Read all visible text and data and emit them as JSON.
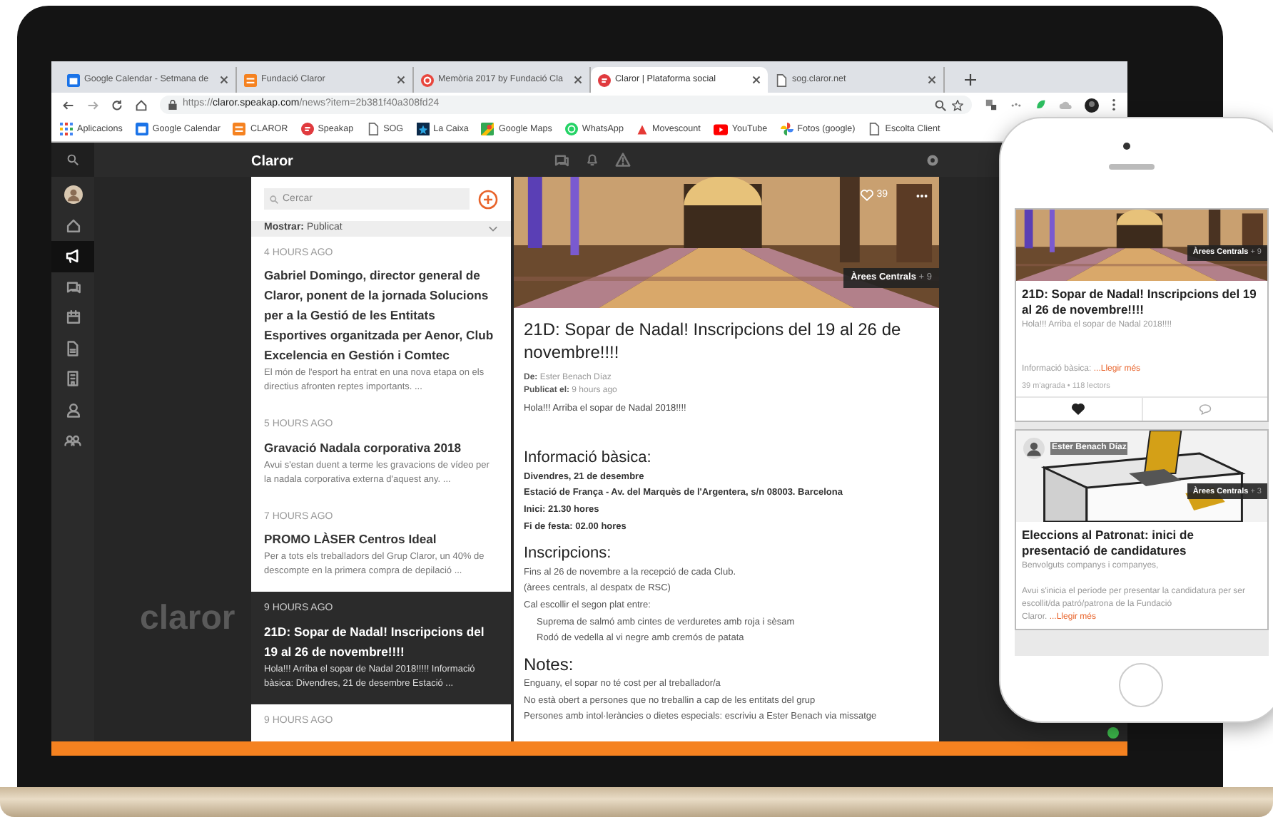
{
  "browser": {
    "tabs": [
      {
        "kind": "calendar",
        "title": "Google Calendar - Setmana de",
        "selected": false
      },
      {
        "kind": "claror",
        "title": "Fundació Claror",
        "selected": false
      },
      {
        "kind": "target",
        "title": "Memòria 2017 by Fundació Cla",
        "selected": false
      },
      {
        "kind": "speakap",
        "title": "Claror | Plataforma social",
        "selected": true
      },
      {
        "kind": "page",
        "title": "sog.claror.net",
        "selected": false
      }
    ],
    "url": {
      "scheme": "https://",
      "host": "claror.speakap.com",
      "path": "/news?item=2b381f40a308fd24"
    },
    "bookmarks": [
      {
        "kind": "apps",
        "label": "Aplicacions"
      },
      {
        "kind": "calendar",
        "label": "Google Calendar"
      },
      {
        "kind": "claror",
        "label": "CLAROR"
      },
      {
        "kind": "speakap",
        "label": "Speakap"
      },
      {
        "kind": "page",
        "label": "SOG"
      },
      {
        "kind": "bank",
        "label": "La Caixa"
      },
      {
        "kind": "maps",
        "label": "Google Maps"
      },
      {
        "kind": "whatsapp",
        "label": "WhatsApp"
      },
      {
        "kind": "triangle",
        "label": "Movescount"
      },
      {
        "kind": "youtube",
        "label": "YouTube"
      },
      {
        "kind": "photos",
        "label": "Fotos (google)"
      },
      {
        "kind": "page",
        "label": "Escolta Client"
      }
    ]
  },
  "app": {
    "title": "Claror",
    "logo": "claror",
    "sidebar": [
      {
        "kind": "avatar",
        "selected": false
      },
      {
        "kind": "home",
        "selected": false
      },
      {
        "kind": "megaphone",
        "selected": true
      },
      {
        "kind": "chat",
        "selected": false
      },
      {
        "kind": "calendar",
        "selected": false
      },
      {
        "kind": "document",
        "selected": false
      },
      {
        "kind": "building",
        "selected": false
      },
      {
        "kind": "user",
        "selected": false
      },
      {
        "kind": "group",
        "selected": false
      }
    ],
    "feed": {
      "search_placeholder": "Cercar",
      "filter_label": "Mostrar:",
      "filter_value": "Publicat",
      "items": [
        {
          "time": "4 HOURS AGO",
          "title": "Gabriel Domingo, director general de Claror, ponent de la jornada Solucions per a la Gestió de les Entitats Esportives organitzada per Aenor, Club Excelencia en Gestión i Comtec",
          "excerpt": "El món de l'esport ha entrat en una nova etapa on els directius afronten reptes importants. ...",
          "selected": false
        },
        {
          "time": "5 HOURS AGO",
          "title": "Gravació Nadala corporativa 2018",
          "excerpt": "Avui s'estan duent a terme les gravacions de vídeo per la nadala corporativa externa d'aquest any. ...",
          "selected": false
        },
        {
          "time": "7 HOURS AGO",
          "title": "PROMO LÀSER Centros Ideal",
          "excerpt": "Per a tots els treballadors del Grup Claror, un 40% de descompte en la primera compra de depilació ...",
          "selected": false
        },
        {
          "time": "9 HOURS AGO",
          "title": "21D: Sopar de Nadal! Inscripcions del 19 al 26 de novembre!!!!",
          "excerpt": "Hola!!! Arriba el sopar de Nadal 2018!!!!! Informació bàsica: Divendres, 21 de desembre Estació ...",
          "selected": true
        },
        {
          "time": "9 HOURS AGO",
          "selected": false
        }
      ]
    },
    "post": {
      "likes": "39",
      "tag": "Àrees Centrals",
      "tag_count": "+ 9",
      "title": "21D: Sopar de Nadal! Inscripcions del 19 al 26 de novembre!!!!",
      "from_label": "De:",
      "author": "Ester Benach Díaz",
      "published_label": "Publicat el:",
      "published": "9 hours ago",
      "intro": "Hola!!! Arriba el sopar de Nadal 2018!!!!",
      "sections": [
        {
          "heading": "Informació bàsica:",
          "lines": [
            {
              "kind": "bold",
              "text": "Divendres, 21 de desembre"
            },
            {
              "kind": "bold",
              "text": "Estació de França - Av. del Marquès de l'Argentera, s/n 08003. Barcelona"
            },
            {
              "kind": "bold",
              "text": "Inici: 21.30 hores"
            },
            {
              "kind": "bold",
              "text": "Fi de festa: 02.00 hores"
            }
          ]
        },
        {
          "heading": "Inscripcions:",
          "lines": [
            {
              "kind": "plain",
              "text": "Fins al 26 de novembre a la recepció de cada Club."
            },
            {
              "kind": "plain",
              "text": "(àrees centrals, al despatx de RSC)"
            },
            {
              "kind": "plain",
              "text": "Cal escollir el segon plat entre:"
            },
            {
              "kind": "indented",
              "text": "Suprema de salmó amb cintes de verduretes amb roja i sèsam"
            },
            {
              "kind": "indented",
              "text": "Rodó de vedella al vi negre amb cremós de patata"
            }
          ]
        },
        {
          "heading": "Notes:",
          "lines": [
            {
              "kind": "plain",
              "text": "Enguany, el sopar no té cost per al treballador/a"
            },
            {
              "kind": "plain",
              "text": "No està obert a persones que no treballin a cap de les entitats del grup"
            },
            {
              "kind": "plain",
              "text": "Persones amb intol·leràncies o dietes especials: escriviu a Ester Benach via missatge"
            }
          ]
        }
      ]
    }
  },
  "phone": {
    "cards": [
      {
        "kind": "banquet",
        "tag": "Àrees Centrals",
        "tag_count": "+ 9",
        "title": "21D: Sopar de Nadal! Inscripcions del 19 al 26 de novembre!!!!",
        "texts": [
          "Hola!!! Arriba el sopar de Nadal 2018!!!!"
        ],
        "summary": "Informació bàsica:",
        "more": "...Llegir més",
        "stats": "39 m'agrada • 118 lectors",
        "liked": true
      },
      {
        "kind": "ballot",
        "author": "Ester Benach Díaz",
        "tag": "Àrees Centrals",
        "tag_count": "+ 3",
        "title": "Eleccions al Patronat: inici de presentació de candidatures",
        "texts": [
          "Benvolguts companys i companyes,",
          "Avui s'inicia el període per presentar la candidatura per ser escollit/da patró/patrona de la Fundació"
        ],
        "summary": "Claror.",
        "more": "...Llegir més"
      }
    ]
  }
}
